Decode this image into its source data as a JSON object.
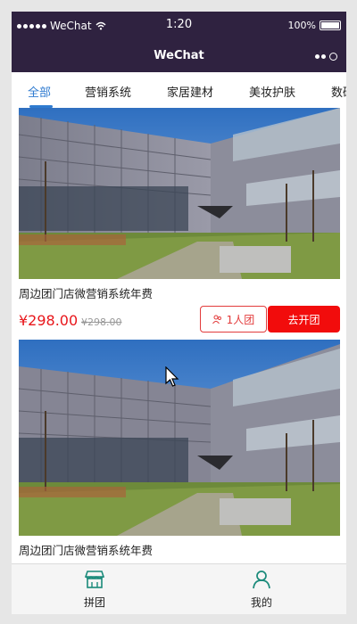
{
  "status_bar": {
    "carrier": "WeChat",
    "time": "1:20",
    "battery": "100%",
    "signal_icon": "signal-dots-icon",
    "wifi_icon": "wifi-icon"
  },
  "nav": {
    "title": "WeChat",
    "more_icon": "more-dots-icon"
  },
  "tabs": [
    {
      "label": "全部",
      "active": true
    },
    {
      "label": "营销系统",
      "active": false
    },
    {
      "label": "家居建材",
      "active": false
    },
    {
      "label": "美妆护肤",
      "active": false
    },
    {
      "label": "数码",
      "active": false
    }
  ],
  "products": [
    {
      "title": "周边团门店微营销系统年费",
      "price": "¥298.00",
      "original_price": "¥298.00",
      "group_label": "1人团",
      "action_label": "去开团"
    },
    {
      "title": "周边团门店微营销系统年费"
    }
  ],
  "tabbar": [
    {
      "label": "拼团",
      "icon": "store-icon"
    },
    {
      "label": "我的",
      "icon": "person-icon"
    }
  ],
  "colors": {
    "header_bg": "#2f2240",
    "accent_blue": "#2f7bd0",
    "price_red": "#e8161b",
    "action_red": "#f20c0c",
    "tabbar_icon": "#1a8a7a"
  }
}
